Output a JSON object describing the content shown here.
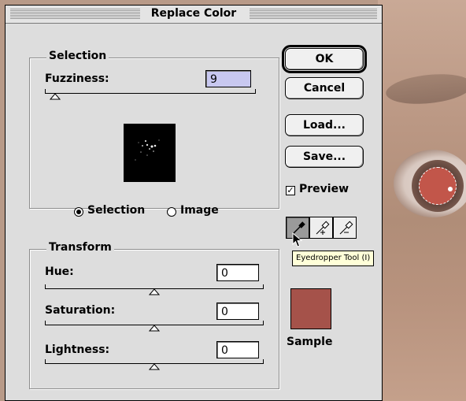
{
  "dialog": {
    "title": "Replace Color"
  },
  "selection": {
    "group_label": "Selection",
    "fuzziness_label": "Fuzziness:",
    "fuzziness_value": "9",
    "fuzziness_level": 0.05,
    "radio_selection_label": "Selection",
    "radio_image_label": "Image",
    "selected_radio": "Selection"
  },
  "transform": {
    "group_label": "Transform",
    "hue_label": "Hue:",
    "hue_value": "0",
    "saturation_label": "Saturation:",
    "saturation_value": "0",
    "lightness_label": "Lightness:",
    "lightness_value": "0",
    "sample_label": "Sample",
    "sample_color": "#a5524a"
  },
  "buttons": {
    "ok": "OK",
    "cancel": "Cancel",
    "load": "Load...",
    "save": "Save..."
  },
  "preview": {
    "label": "Preview",
    "checked": true
  },
  "tools": {
    "items": [
      {
        "name": "eyedropper-tool",
        "active": true
      },
      {
        "name": "eyedropper-plus-tool",
        "active": false
      },
      {
        "name": "eyedropper-minus-tool",
        "active": false
      }
    ],
    "tooltip": "Eyedropper Tool (I)"
  },
  "colors": {
    "selected_field": "#c8c8f0",
    "dialog_bg": "#dddddd"
  }
}
